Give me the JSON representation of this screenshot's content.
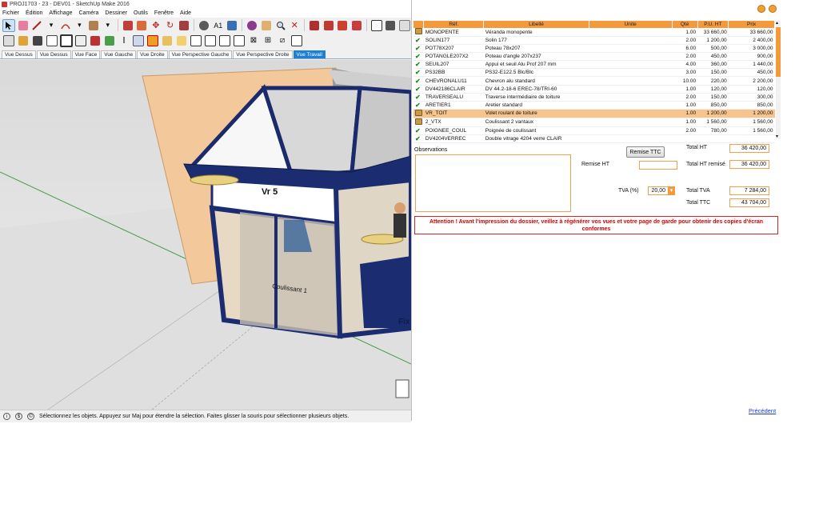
{
  "sketchup": {
    "title": "PROJ1703 - 23 - DEV01 - SketchUp Make 2016",
    "menu": [
      "Fichier",
      "Édition",
      "Affichage",
      "Caméra",
      "Dessiner",
      "Outils",
      "Fenêtre",
      "Aide"
    ],
    "scenes": [
      "Vue Dessus",
      "Vue Dessus",
      "Vue Face",
      "Vue Gauche",
      "Vue Droite",
      "Vue Perspective Gauche",
      "Vue Perspective Droite",
      "Vue Travail"
    ],
    "active_scene": "Vue Travail",
    "status": "Sélectionnez les objets. Appuyez sur Maj pour étendre la sélection. Faites glisser la souris pour sélectionner plusieurs objets.",
    "model_labels": {
      "front_panel": "Vr 5",
      "door": "Coulissant 1",
      "right_text": "Fix"
    }
  },
  "quote": {
    "columns": {
      "ref": "Réf.",
      "libelle": "Libellé",
      "unite": "Unite",
      "qte": "Qté",
      "pu_ht": "P.U. HT",
      "prix": "Prix"
    },
    "rows": [
      {
        "icon": "package",
        "ref": "MONOPENTE",
        "libelle": "Véranda monopente",
        "unite": "",
        "qte": "1.00",
        "pu": "33 660,00",
        "prix": "33 660,00"
      },
      {
        "icon": "check",
        "ref": "SOLIN177",
        "libelle": "Solin 177",
        "unite": "",
        "qte": "2.00",
        "pu": "1 200,00",
        "prix": "2 400,00"
      },
      {
        "icon": "check",
        "ref": "POT78X207",
        "libelle": "Poteau 78x207",
        "unite": "",
        "qte": "6.00",
        "pu": "500,00",
        "prix": "3 000,00"
      },
      {
        "icon": "check",
        "ref": "POTANGLE207X2",
        "libelle": "Poteau d'angle 207x237",
        "unite": "",
        "qte": "2.00",
        "pu": "450,00",
        "prix": "900,00"
      },
      {
        "icon": "check",
        "ref": "SEUIL207",
        "libelle": "Appui et seuil Alu Prof 207 mm",
        "unite": "",
        "qte": "4.00",
        "pu": "360,00",
        "prix": "1 440,00"
      },
      {
        "icon": "check",
        "ref": "PS32BB",
        "libelle": "PS32-E122.5 Blc/Blc",
        "unite": "",
        "qte": "3.00",
        "pu": "150,00",
        "prix": "450,00"
      },
      {
        "icon": "check",
        "ref": "CHEVRONALU11",
        "libelle": "Chevron alu standard",
        "unite": "",
        "qte": "10.00",
        "pu": "220,00",
        "prix": "2 200,00"
      },
      {
        "icon": "check",
        "ref": "DV442186CLAIR",
        "libelle": "DV 44.2-18-6 EREC-78/TRI-60",
        "unite": "",
        "qte": "1.00",
        "pu": "120,00",
        "prix": "120,00"
      },
      {
        "icon": "check",
        "ref": "TRAVERSEALU",
        "libelle": "Traverse intermédiaire de toiture",
        "unite": "",
        "qte": "2.00",
        "pu": "150,00",
        "prix": "300,00"
      },
      {
        "icon": "check",
        "ref": "ARETIER1",
        "libelle": "Aretier standard",
        "unite": "",
        "qte": "1.00",
        "pu": "850,00",
        "prix": "850,00"
      },
      {
        "icon": "package",
        "ref": "VR_TOIT",
        "libelle": "Volet roulant de toiture",
        "unite": "",
        "qte": "1.00",
        "pu": "1 200,00",
        "prix": "1 200,00",
        "highlight": true
      },
      {
        "icon": "package",
        "ref": "2_VTX",
        "libelle": "Coulissant 2 vantaux",
        "unite": "",
        "qte": "1.00",
        "pu": "1 560,00",
        "prix": "1 560,00"
      },
      {
        "icon": "check",
        "ref": "POIGNEE_COUL",
        "libelle": "Poignée de coulissant",
        "unite": "",
        "qte": "2.00",
        "pu": "780,00",
        "prix": "1 560,00"
      },
      {
        "icon": "check",
        "ref": "DV4204VERREC",
        "libelle": "Double vitrage 4204 verre CLAIR",
        "unite": "",
        "qte": "",
        "pu": "",
        "prix": ""
      }
    ],
    "observations_label": "Observations",
    "remise_ttc_button": "Remise TTC",
    "remise_ht_label": "Remise HT",
    "remise_ht_value": "",
    "total_ht_label": "Total HT",
    "total_ht_value": "36 420,00",
    "total_ht_remise_label": "Total HT remisé",
    "total_ht_remise_value": "36 420,00",
    "tva_label": "TVA (%)",
    "tva_value": "20,00",
    "total_tva_label": "Total TVA",
    "total_tva_value": "7 284,00",
    "total_ttc_label": "Total TTC",
    "total_ttc_value": "43 704,00",
    "warning": "Attention ! Avant l'impression du dossier, veillez à régénérer vos vues et votre page de garde pour obtenir des copies d'écran conformes",
    "prev_link": "Précédent",
    "accent_color": "#f49a3c"
  }
}
